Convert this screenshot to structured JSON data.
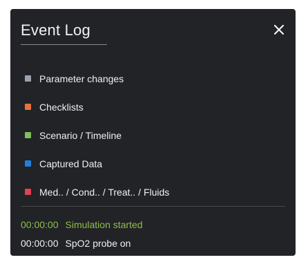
{
  "window": {
    "title": "Event Log",
    "close_icon": "close-icon"
  },
  "legend": {
    "items": [
      {
        "label": "Parameter changes",
        "color": "#9aa3ad"
      },
      {
        "label": "Checklists",
        "color": "#e8713a"
      },
      {
        "label": "Scenario / Timeline",
        "color": "#7fbf5a"
      },
      {
        "label": "Captured Data",
        "color": "#1f7fe0"
      },
      {
        "label": "Med.. / Cond.. / Treat.. / Fluids",
        "color": "#e0434f"
      }
    ]
  },
  "log": {
    "entries": [
      {
        "time": "00:00:00",
        "text": "Simulation started",
        "color": "#8fbf4a"
      },
      {
        "time": "00:00:00",
        "text": "SpO2 probe on",
        "color": "#f0f0f0"
      }
    ]
  }
}
